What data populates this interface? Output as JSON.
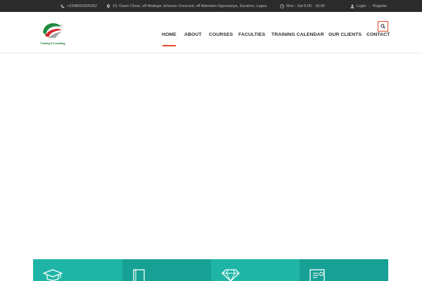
{
  "topbar": {
    "phone": "+2348032905352",
    "address": "19, Oseni Close, off Modupe Johnson Crescent, off Adeniran Ogunsanya, Surulere, Lagos",
    "hours": "Mon - Sat 8.00 - 18.00",
    "login": "Login",
    "separator": "|",
    "register": "Register",
    "icons": [
      "phone-icon",
      "map-pin-icon",
      "clock-icon",
      "user-icon"
    ]
  },
  "logo": {
    "text": "Training & Consulting",
    "colors": {
      "green": "#1e8a3e",
      "red": "#d6262b",
      "grey": "#a8a8a8"
    }
  },
  "nav": {
    "items": [
      "HOME",
      "ABOUT",
      "COURSES",
      "FACULTIES",
      "TRAINING CALENDAR",
      "OUR CLIENTS",
      "CONTACT"
    ],
    "active": "HOME",
    "accent": "#e24b2f"
  },
  "search": {
    "icon": "search-icon"
  },
  "features": {
    "colors": [
      "#1fb5a6",
      "#17a094",
      "#1fb5a6",
      "#17a094"
    ],
    "icons": [
      "graduation-cap-icon",
      "book-icon",
      "diamond-icon",
      "certificate-icon"
    ]
  }
}
